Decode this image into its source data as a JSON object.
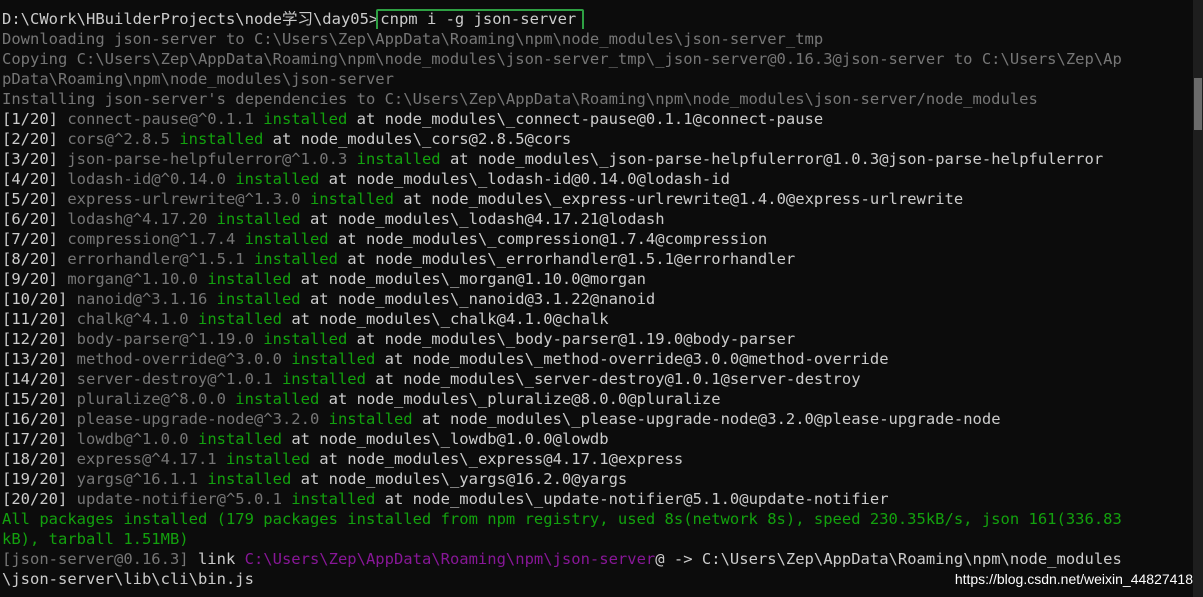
{
  "prompt": {
    "path": "D:\\CWork\\HBuilderProjects\\node学习\\day05>",
    "command": "cnpm i -g json-server"
  },
  "lines": [
    {
      "segs": [
        {
          "t": "Downloading json-server to C:\\Users\\Zep\\AppData\\Roaming\\npm\\node_modules\\json-server_tmp",
          "c": "gray"
        }
      ]
    },
    {
      "segs": [
        {
          "t": "Copying C:\\Users\\Zep\\AppData\\Roaming\\npm\\node_modules\\json-server_tmp\\_json-server@0.16.3@json-server to C:\\Users\\Zep\\Ap",
          "c": "gray"
        }
      ]
    },
    {
      "segs": [
        {
          "t": "pData\\Roaming\\npm\\node_modules\\json-server",
          "c": "gray"
        }
      ]
    },
    {
      "segs": [
        {
          "t": "Installing json-server's dependencies to C:\\Users\\Zep\\AppData\\Roaming\\npm\\node_modules\\json-server/node_modules",
          "c": "gray"
        }
      ]
    },
    {
      "segs": [
        {
          "t": "[1/20] ",
          "c": "white"
        },
        {
          "t": "connect-pause@^0.1.1 ",
          "c": "gray"
        },
        {
          "t": "installed",
          "c": "green"
        },
        {
          "t": " at node_modules\\_connect-pause@0.1.1@connect-pause",
          "c": "white"
        }
      ]
    },
    {
      "segs": [
        {
          "t": "[2/20] ",
          "c": "white"
        },
        {
          "t": "cors@^2.8.5 ",
          "c": "gray"
        },
        {
          "t": "installed",
          "c": "green"
        },
        {
          "t": " at node_modules\\_cors@2.8.5@cors",
          "c": "white"
        }
      ]
    },
    {
      "segs": [
        {
          "t": "[3/20] ",
          "c": "white"
        },
        {
          "t": "json-parse-helpfulerror@^1.0.3 ",
          "c": "gray"
        },
        {
          "t": "installed",
          "c": "green"
        },
        {
          "t": " at node_modules\\_json-parse-helpfulerror@1.0.3@json-parse-helpfulerror",
          "c": "white"
        }
      ]
    },
    {
      "segs": [
        {
          "t": "[4/20] ",
          "c": "white"
        },
        {
          "t": "lodash-id@^0.14.0 ",
          "c": "gray"
        },
        {
          "t": "installed",
          "c": "green"
        },
        {
          "t": " at node_modules\\_lodash-id@0.14.0@lodash-id",
          "c": "white"
        }
      ]
    },
    {
      "segs": [
        {
          "t": "[5/20] ",
          "c": "white"
        },
        {
          "t": "express-urlrewrite@^1.3.0 ",
          "c": "gray"
        },
        {
          "t": "installed",
          "c": "green"
        },
        {
          "t": " at node_modules\\_express-urlrewrite@1.4.0@express-urlrewrite",
          "c": "white"
        }
      ]
    },
    {
      "segs": [
        {
          "t": "[6/20] ",
          "c": "white"
        },
        {
          "t": "lodash@^4.17.20 ",
          "c": "gray"
        },
        {
          "t": "installed",
          "c": "green"
        },
        {
          "t": " at node_modules\\_lodash@4.17.21@lodash",
          "c": "white"
        }
      ]
    },
    {
      "segs": [
        {
          "t": "[7/20] ",
          "c": "white"
        },
        {
          "t": "compression@^1.7.4 ",
          "c": "gray"
        },
        {
          "t": "installed",
          "c": "green"
        },
        {
          "t": " at node_modules\\_compression@1.7.4@compression",
          "c": "white"
        }
      ]
    },
    {
      "segs": [
        {
          "t": "[8/20] ",
          "c": "white"
        },
        {
          "t": "errorhandler@^1.5.1 ",
          "c": "gray"
        },
        {
          "t": "installed",
          "c": "green"
        },
        {
          "t": " at node_modules\\_errorhandler@1.5.1@errorhandler",
          "c": "white"
        }
      ]
    },
    {
      "segs": [
        {
          "t": "[9/20] ",
          "c": "white"
        },
        {
          "t": "morgan@^1.10.0 ",
          "c": "gray"
        },
        {
          "t": "installed",
          "c": "green"
        },
        {
          "t": " at node_modules\\_morgan@1.10.0@morgan",
          "c": "white"
        }
      ]
    },
    {
      "segs": [
        {
          "t": "[10/20] ",
          "c": "white"
        },
        {
          "t": "nanoid@^3.1.16 ",
          "c": "gray"
        },
        {
          "t": "installed",
          "c": "green"
        },
        {
          "t": " at node_modules\\_nanoid@3.1.22@nanoid",
          "c": "white"
        }
      ]
    },
    {
      "segs": [
        {
          "t": "[11/20] ",
          "c": "white"
        },
        {
          "t": "chalk@^4.1.0 ",
          "c": "gray"
        },
        {
          "t": "installed",
          "c": "green"
        },
        {
          "t": " at node_modules\\_chalk@4.1.0@chalk",
          "c": "white"
        }
      ]
    },
    {
      "segs": [
        {
          "t": "[12/20] ",
          "c": "white"
        },
        {
          "t": "body-parser@^1.19.0 ",
          "c": "gray"
        },
        {
          "t": "installed",
          "c": "green"
        },
        {
          "t": " at node_modules\\_body-parser@1.19.0@body-parser",
          "c": "white"
        }
      ]
    },
    {
      "segs": [
        {
          "t": "[13/20] ",
          "c": "white"
        },
        {
          "t": "method-override@^3.0.0 ",
          "c": "gray"
        },
        {
          "t": "installed",
          "c": "green"
        },
        {
          "t": " at node_modules\\_method-override@3.0.0@method-override",
          "c": "white"
        }
      ]
    },
    {
      "segs": [
        {
          "t": "[14/20] ",
          "c": "white"
        },
        {
          "t": "server-destroy@^1.0.1 ",
          "c": "gray"
        },
        {
          "t": "installed",
          "c": "green"
        },
        {
          "t": " at node_modules\\_server-destroy@1.0.1@server-destroy",
          "c": "white"
        }
      ]
    },
    {
      "segs": [
        {
          "t": "[15/20] ",
          "c": "white"
        },
        {
          "t": "pluralize@^8.0.0 ",
          "c": "gray"
        },
        {
          "t": "installed",
          "c": "green"
        },
        {
          "t": " at node_modules\\_pluralize@8.0.0@pluralize",
          "c": "white"
        }
      ]
    },
    {
      "segs": [
        {
          "t": "[16/20] ",
          "c": "white"
        },
        {
          "t": "please-upgrade-node@^3.2.0 ",
          "c": "gray"
        },
        {
          "t": "installed",
          "c": "green"
        },
        {
          "t": " at node_modules\\_please-upgrade-node@3.2.0@please-upgrade-node",
          "c": "white"
        }
      ]
    },
    {
      "segs": [
        {
          "t": "[17/20] ",
          "c": "white"
        },
        {
          "t": "lowdb@^1.0.0 ",
          "c": "gray"
        },
        {
          "t": "installed",
          "c": "green"
        },
        {
          "t": " at node_modules\\_lowdb@1.0.0@lowdb",
          "c": "white"
        }
      ]
    },
    {
      "segs": [
        {
          "t": "[18/20] ",
          "c": "white"
        },
        {
          "t": "express@^4.17.1 ",
          "c": "gray"
        },
        {
          "t": "installed",
          "c": "green"
        },
        {
          "t": " at node_modules\\_express@4.17.1@express",
          "c": "white"
        }
      ]
    },
    {
      "segs": [
        {
          "t": "[19/20] ",
          "c": "white"
        },
        {
          "t": "yargs@^16.1.1 ",
          "c": "gray"
        },
        {
          "t": "installed",
          "c": "green"
        },
        {
          "t": " at node_modules\\_yargs@16.2.0@yargs",
          "c": "white"
        }
      ]
    },
    {
      "segs": [
        {
          "t": "[20/20] ",
          "c": "white"
        },
        {
          "t": "update-notifier@^5.0.1 ",
          "c": "gray"
        },
        {
          "t": "installed",
          "c": "green"
        },
        {
          "t": " at node_modules\\_update-notifier@5.1.0@update-notifier",
          "c": "white"
        }
      ]
    },
    {
      "segs": [
        {
          "t": "All packages installed (179 packages installed from npm registry, used 8s(network 8s), speed 230.35kB/s, json 161(336.83",
          "c": "green"
        }
      ]
    },
    {
      "segs": [
        {
          "t": "kB), tarball 1.51MB)",
          "c": "green"
        }
      ]
    },
    {
      "segs": [
        {
          "t": "[json-server@0.16.3]",
          "c": "gray"
        },
        {
          "t": " link ",
          "c": "white"
        },
        {
          "t": "C:\\Users\\Zep\\AppData\\Roaming\\npm\\json-server",
          "c": "purple"
        },
        {
          "t": "@ -> C:\\Users\\Zep\\AppData\\Roaming\\npm\\node_modules",
          "c": "white"
        }
      ]
    },
    {
      "segs": [
        {
          "t": "\\json-server\\lib\\cli\\bin.js",
          "c": "white"
        }
      ]
    }
  ],
  "watermark": "https://blog.csdn.net/weixin_44827418",
  "colors": {
    "background": "#0c0c0c",
    "text": "#cccccc",
    "dim": "#767676",
    "success": "#13a10e",
    "link": "#881798",
    "highlight_box": "#2ea043"
  }
}
